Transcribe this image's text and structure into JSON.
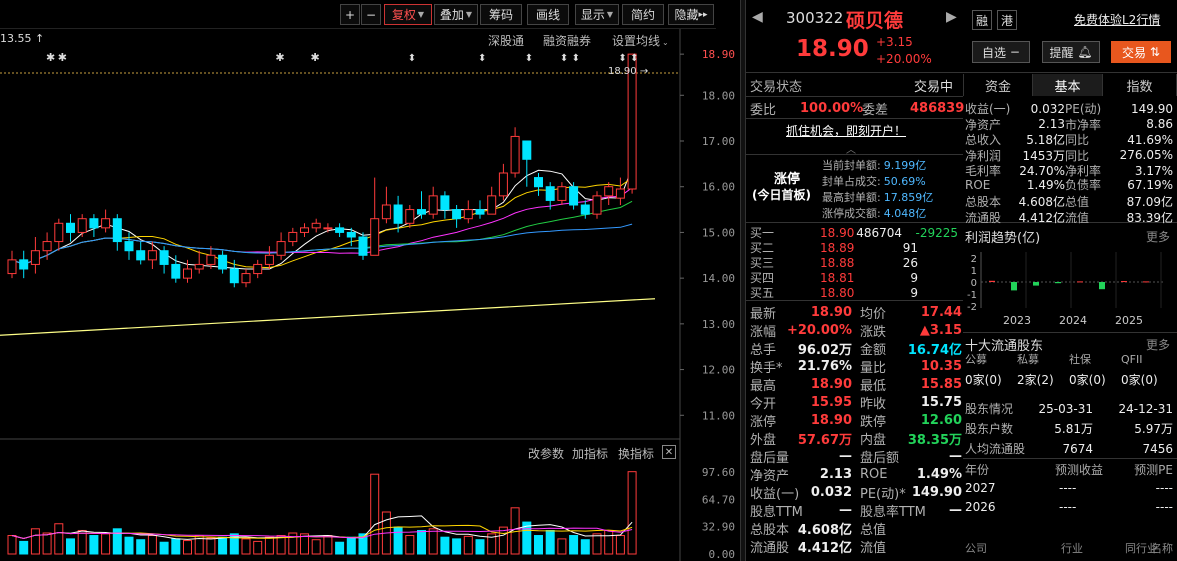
{
  "toolbar": {
    "plus": "+",
    "minus": "−",
    "restore": "复权",
    "overlay": "叠加",
    "chips": "筹码",
    "draw": "画线",
    "display": "显示",
    "simple": "简约",
    "hide": "隐藏",
    "more": "▸▸"
  },
  "chart": {
    "high_marker": "13.55",
    "indicators": {
      "sz": "深股通",
      "margin": "融资融券",
      "ma": "设置均线"
    },
    "last_label": "18.90",
    "price_axis": [
      "18.90",
      "18.00",
      "17.00",
      "16.00",
      "15.00",
      "14.00",
      "13.00",
      "12.00",
      "11.00"
    ],
    "vol_toolbar": {
      "params": "改参数",
      "add": "加指标",
      "switch": "换指标",
      "close": "✕"
    },
    "vol_axis": [
      "97.60",
      "64.70",
      "32.90",
      "0.00"
    ],
    "candles": [
      {
        "o": 14.1,
        "c": 14.4,
        "h": 14.6,
        "l": 14.0
      },
      {
        "o": 14.4,
        "c": 14.2,
        "h": 14.6,
        "l": 14.0
      },
      {
        "o": 14.3,
        "c": 14.6,
        "h": 14.9,
        "l": 14.1
      },
      {
        "o": 14.6,
        "c": 14.8,
        "h": 15.0,
        "l": 14.4
      },
      {
        "o": 14.8,
        "c": 15.2,
        "h": 15.3,
        "l": 14.6
      },
      {
        "o": 15.2,
        "c": 15.0,
        "h": 15.4,
        "l": 14.8
      },
      {
        "o": 15.0,
        "c": 15.3,
        "h": 15.4,
        "l": 14.9
      },
      {
        "o": 15.3,
        "c": 15.1,
        "h": 15.4,
        "l": 14.9
      },
      {
        "o": 15.1,
        "c": 15.3,
        "h": 15.5,
        "l": 15.0
      },
      {
        "o": 15.3,
        "c": 14.8,
        "h": 15.4,
        "l": 14.6
      },
      {
        "o": 14.8,
        "c": 14.6,
        "h": 15.0,
        "l": 14.4
      },
      {
        "o": 14.6,
        "c": 14.4,
        "h": 14.8,
        "l": 14.3
      },
      {
        "o": 14.4,
        "c": 14.6,
        "h": 14.8,
        "l": 14.2
      },
      {
        "o": 14.6,
        "c": 14.3,
        "h": 14.7,
        "l": 14.1
      },
      {
        "o": 14.3,
        "c": 14.0,
        "h": 14.5,
        "l": 13.9
      },
      {
        "o": 14.0,
        "c": 14.2,
        "h": 14.4,
        "l": 13.9
      },
      {
        "o": 14.2,
        "c": 14.3,
        "h": 14.6,
        "l": 14.1
      },
      {
        "o": 14.3,
        "c": 14.5,
        "h": 14.7,
        "l": 14.2
      },
      {
        "o": 14.5,
        "c": 14.2,
        "h": 14.6,
        "l": 14.1
      },
      {
        "o": 14.2,
        "c": 13.9,
        "h": 14.4,
        "l": 13.8
      },
      {
        "o": 13.9,
        "c": 14.1,
        "h": 14.2,
        "l": 13.8
      },
      {
        "o": 14.1,
        "c": 14.3,
        "h": 14.4,
        "l": 14.0
      },
      {
        "o": 14.3,
        "c": 14.5,
        "h": 14.7,
        "l": 14.2
      },
      {
        "o": 14.5,
        "c": 14.8,
        "h": 15.0,
        "l": 14.4
      },
      {
        "o": 14.8,
        "c": 15.0,
        "h": 15.1,
        "l": 14.7
      },
      {
        "o": 15.0,
        "c": 15.1,
        "h": 15.2,
        "l": 14.9
      },
      {
        "o": 15.1,
        "c": 15.2,
        "h": 15.3,
        "l": 15.0
      },
      {
        "o": 15.1,
        "c": 15.1,
        "h": 15.2,
        "l": 15.0
      },
      {
        "o": 15.1,
        "c": 15.0,
        "h": 15.2,
        "l": 14.9
      },
      {
        "o": 15.0,
        "c": 14.9,
        "h": 15.1,
        "l": 14.7
      },
      {
        "o": 14.9,
        "c": 14.5,
        "h": 15.0,
        "l": 14.4
      },
      {
        "o": 14.5,
        "c": 15.3,
        "h": 16.2,
        "l": 14.5
      },
      {
        "o": 15.3,
        "c": 15.6,
        "h": 16.0,
        "l": 15.2
      },
      {
        "o": 15.6,
        "c": 15.2,
        "h": 15.8,
        "l": 15.0
      },
      {
        "o": 15.2,
        "c": 15.5,
        "h": 15.6,
        "l": 15.1
      },
      {
        "o": 15.5,
        "c": 15.4,
        "h": 15.9,
        "l": 15.3
      },
      {
        "o": 15.4,
        "c": 15.8,
        "h": 16.0,
        "l": 15.3
      },
      {
        "o": 15.8,
        "c": 15.5,
        "h": 15.9,
        "l": 15.3
      },
      {
        "o": 15.5,
        "c": 15.3,
        "h": 15.6,
        "l": 15.1
      },
      {
        "o": 15.3,
        "c": 15.5,
        "h": 15.7,
        "l": 15.2
      },
      {
        "o": 15.5,
        "c": 15.4,
        "h": 15.7,
        "l": 15.3
      },
      {
        "o": 15.4,
        "c": 15.8,
        "h": 16.0,
        "l": 15.4
      },
      {
        "o": 15.8,
        "c": 16.3,
        "h": 16.5,
        "l": 15.7
      },
      {
        "o": 16.3,
        "c": 17.1,
        "h": 17.3,
        "l": 16.2
      },
      {
        "o": 17.0,
        "c": 16.6,
        "h": 17.0,
        "l": 16.0
      },
      {
        "o": 16.2,
        "c": 16.0,
        "h": 16.3,
        "l": 15.8
      },
      {
        "o": 16.0,
        "c": 15.7,
        "h": 16.1,
        "l": 15.5
      },
      {
        "o": 15.7,
        "c": 16.0,
        "h": 16.1,
        "l": 15.6
      },
      {
        "o": 16.0,
        "c": 15.6,
        "h": 16.1,
        "l": 15.5
      },
      {
        "o": 15.6,
        "c": 15.4,
        "h": 15.7,
        "l": 15.3
      },
      {
        "o": 15.4,
        "c": 15.8,
        "h": 15.9,
        "l": 15.3
      },
      {
        "o": 15.8,
        "c": 16.0,
        "h": 16.1,
        "l": 15.6
      },
      {
        "o": 15.75,
        "c": 15.95,
        "h": 16.2,
        "l": 15.6
      },
      {
        "o": 15.95,
        "c": 18.9,
        "h": 18.9,
        "l": 15.85
      }
    ],
    "volumes": [
      22,
      15,
      30,
      25,
      36,
      18,
      28,
      22,
      24,
      30,
      20,
      17,
      22,
      14,
      18,
      16,
      22,
      19,
      20,
      24,
      18,
      15,
      20,
      22,
      25,
      24,
      17,
      22,
      14,
      20,
      24,
      95,
      50,
      32,
      22,
      28,
      30,
      20,
      18,
      21,
      17,
      24,
      32,
      55,
      38,
      22,
      28,
      18,
      22,
      17,
      24,
      28,
      22,
      98
    ],
    "marks_star": [
      0,
      1,
      22,
      25
    ],
    "marks_diamond": [
      34,
      40,
      44,
      47,
      48,
      52,
      53
    ]
  },
  "stock": {
    "code": "300322",
    "name": "硕贝德",
    "price": "18.90",
    "change": "+3.15",
    "change_pct": "+20.00%",
    "rong": "融",
    "gang": "港",
    "l2": "免费体验L2行情",
    "watch": "自选",
    "alert": "提醒",
    "trade": "交易"
  },
  "tabs": {
    "state_label": "交易状态",
    "state_val": "交易中",
    "t1": "资金",
    "t2": "基本",
    "t3": "指数"
  },
  "weibi": {
    "l1": "委比",
    "v1": "100.00%",
    "l2": "委差",
    "v2": "486839",
    "promo": "抓住机会，即刻开户！"
  },
  "limit": {
    "title": "涨停",
    "sub": "(今日首板)",
    "rows": [
      [
        "当前封单额:",
        "9.199亿"
      ],
      [
        "封单占成交:",
        "50.69%"
      ],
      [
        "最高封单额:",
        "17.859亿"
      ],
      [
        "涨停成交额:",
        "4.048亿"
      ]
    ]
  },
  "bids": [
    [
      "买一",
      "18.90",
      "486704",
      "-29225"
    ],
    [
      "买二",
      "18.89",
      "91",
      ""
    ],
    [
      "买三",
      "18.88",
      "26",
      ""
    ],
    [
      "买四",
      "18.81",
      "9",
      ""
    ],
    [
      "买五",
      "18.80",
      "9",
      ""
    ]
  ],
  "quote": [
    [
      "最新",
      "18.90",
      "均价",
      "17.44"
    ],
    [
      "涨幅",
      "+20.00%",
      "涨跌",
      "▲3.15"
    ],
    [
      "总手",
      "96.02万",
      "金额",
      "16.74亿"
    ],
    [
      "换手*",
      "21.76%",
      "量比",
      "10.35"
    ],
    [
      "最高",
      "18.90",
      "最低",
      "15.85"
    ],
    [
      "今开",
      "15.95",
      "昨收",
      "15.75"
    ],
    [
      "涨停",
      "18.90",
      "跌停",
      "12.60"
    ],
    [
      "外盘",
      "57.67万",
      "内盘",
      "38.35万"
    ],
    [
      "盘后量",
      "—",
      "盘后额",
      "—"
    ],
    [
      "净资产",
      "2.13",
      "ROE",
      "1.49%"
    ],
    [
      "收益(一)",
      "0.032",
      "PE(动)*",
      "149.90"
    ],
    [
      "股息TTM",
      "—",
      "股息率TTM",
      "—"
    ],
    [
      "总股本",
      "4.608亿",
      "总值",
      ""
    ],
    [
      "流通股",
      "4.412亿",
      "流值",
      ""
    ]
  ],
  "fund": [
    [
      "收益(一)",
      "0.032",
      "PE(动)",
      "149.90"
    ],
    [
      "净资产",
      "2.13",
      "市净率",
      "8.86"
    ],
    [
      "总收入",
      "5.18亿",
      "同比",
      "41.69%"
    ],
    [
      "净利润",
      "1453万",
      "同比",
      "276.05%"
    ],
    [
      "毛利率",
      "24.70%",
      "净利率",
      "3.17%"
    ],
    [
      "ROE",
      "1.49%",
      "负债率",
      "67.19%"
    ],
    [
      "总股本",
      "4.608亿",
      "总值",
      "87.09亿"
    ],
    [
      "流通股",
      "4.412亿",
      "流值",
      "83.39亿"
    ]
  ],
  "profit": {
    "title": "利润趋势(亿)",
    "more": "更多",
    "y": [
      "2",
      "1",
      "0",
      "-1",
      "-2"
    ],
    "years": [
      "2023",
      "2024",
      "2025"
    ],
    "bars": [
      0.1,
      -0.7,
      -0.3,
      -0.1,
      0.05,
      -0.6,
      0.08,
      0.05
    ]
  },
  "holders": {
    "title": "十大流通股东",
    "more": "更多",
    "cats": [
      "公募",
      "私募",
      "社保",
      "QFII"
    ],
    "counts": [
      "0家(0)",
      "2家(2)",
      "0家(0)",
      "0家(0)"
    ],
    "r1": [
      "股东情况",
      "25-03-31",
      "24-12-31"
    ],
    "r2": [
      "股东户数",
      "5.81万",
      "5.97万"
    ],
    "r3": [
      "人均流通股",
      "7674",
      "7456"
    ]
  },
  "forecast": {
    "h": [
      "年份",
      "预测收益",
      "预测PE"
    ],
    "rows": [
      [
        "2027",
        "----",
        "----"
      ],
      [
        "2026",
        "----",
        "----"
      ]
    ]
  },
  "footer": {
    "a": "公司",
    "b": "行业",
    "c": "同行业",
    "d": "名称"
  }
}
